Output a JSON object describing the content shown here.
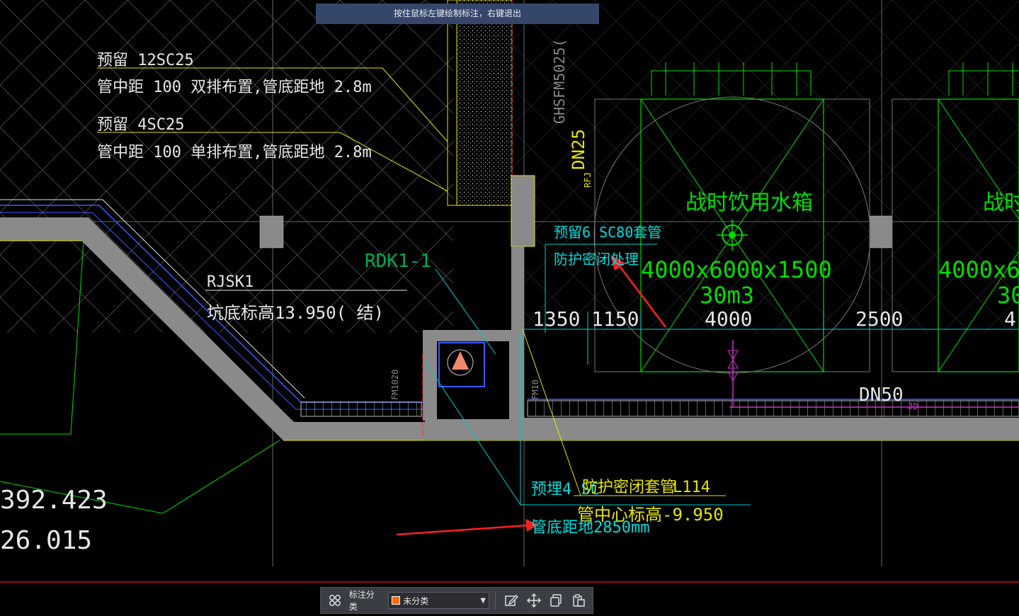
{
  "tooltip": "按住鼠标左键绘制标注，右键退出",
  "drawing": {
    "note1_line1": "预留 12SC25",
    "note1_line2": "管中距  100   双排布置,管底距地        2.8m",
    "note2_line1": "预留 4SC25",
    "note2_line2": "管中距  100   单排布置,管底距地        2.8m",
    "rjsk_label": "RJSK1",
    "pit_elev": "坑底标高13.950(      结)",
    "rdk_label": "RDK1-1",
    "sleeve_line1": "预留6 SC80套管",
    "sleeve_line2": "防护密闭处理",
    "vertical_label": "GHSFM5025(",
    "dn25": "DN25",
    "rfj": "RFJ",
    "tank_title": "战时饮用水箱",
    "tank_dims": "4000x6000x1500",
    "tank_vol": "30m3",
    "tank2_title": "战时",
    "tank2_dims": "4000x6",
    "tank2_vol": "30",
    "dim_1350": "1350",
    "dim_1150": "1150",
    "dim_4000": "4000",
    "dim_2500": "2500",
    "dim_4": "4",
    "dn50": "DN50",
    "jd": "JD",
    "val_1": "392.423",
    "val_2": "26.015",
    "bottom_1": "预埋4 SC",
    "bottom_2": "防护密闭套管",
    "bottom_3": "L114",
    "bottom_4": "管中心标高-9.950",
    "bottom_5": "管底距地2850mm",
    "small_vert_1": "FM1020",
    "small_vert_2": "FM10"
  },
  "toolbar": {
    "label": "标注分类",
    "select_value": "未分类",
    "swatch_color": "#ff6a00",
    "icons": [
      "grid-icon",
      "edit-icon",
      "move-icon",
      "copy-icon",
      "paste-icon"
    ]
  }
}
